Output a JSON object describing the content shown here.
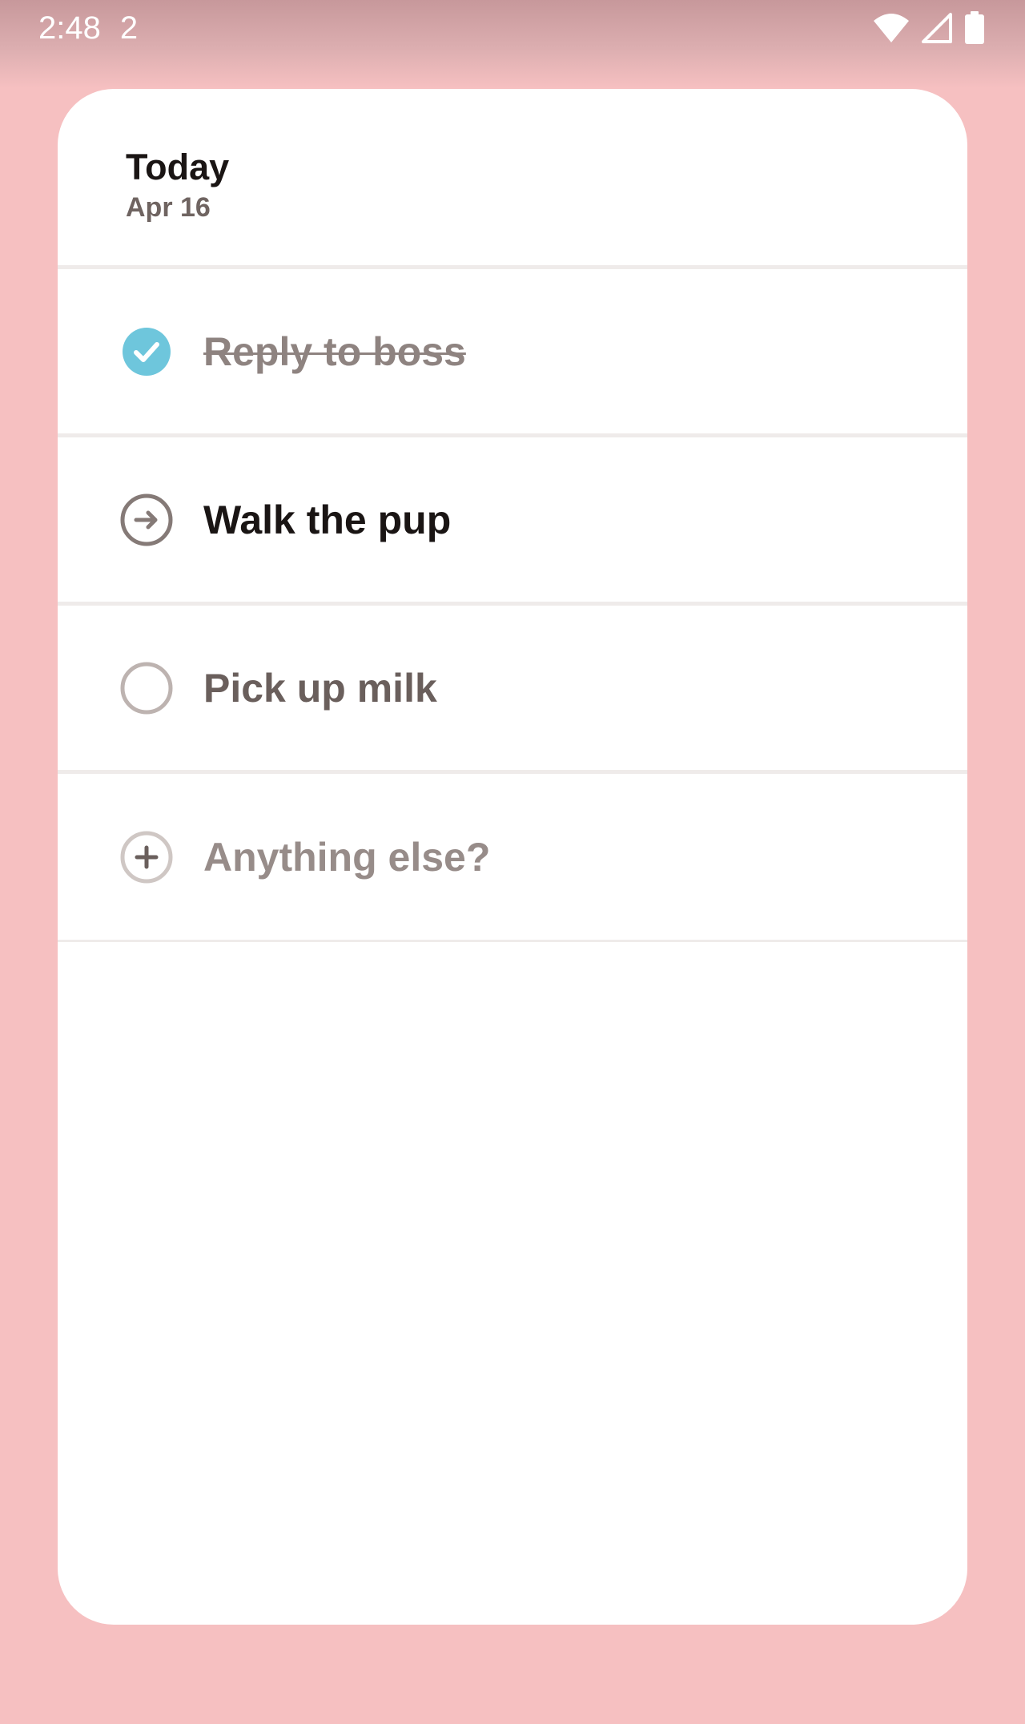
{
  "status_bar": {
    "time": "2:48",
    "notification_count": "2",
    "icons": [
      "wifi-icon",
      "cell-signal-icon",
      "battery-icon"
    ]
  },
  "header": {
    "title": "Today",
    "date": "Apr 16"
  },
  "tasks": [
    {
      "label": "Reply to boss",
      "state": "done",
      "icon": "check-circle-icon"
    },
    {
      "label": "Walk the pup",
      "state": "in-progress",
      "icon": "arrow-right-circle-icon"
    },
    {
      "label": "Pick up milk",
      "state": "pending",
      "icon": "empty-circle-icon"
    }
  ],
  "add_task": {
    "placeholder": "Anything else?",
    "icon": "plus-circle-icon"
  },
  "colors": {
    "background": "#f6c0c1",
    "card": "#ffffff",
    "check_accent": "#6ec6dc",
    "divider": "#efebea",
    "text_primary": "#1a1514",
    "text_secondary": "#6a5f5c",
    "text_muted": "#8e8380"
  }
}
